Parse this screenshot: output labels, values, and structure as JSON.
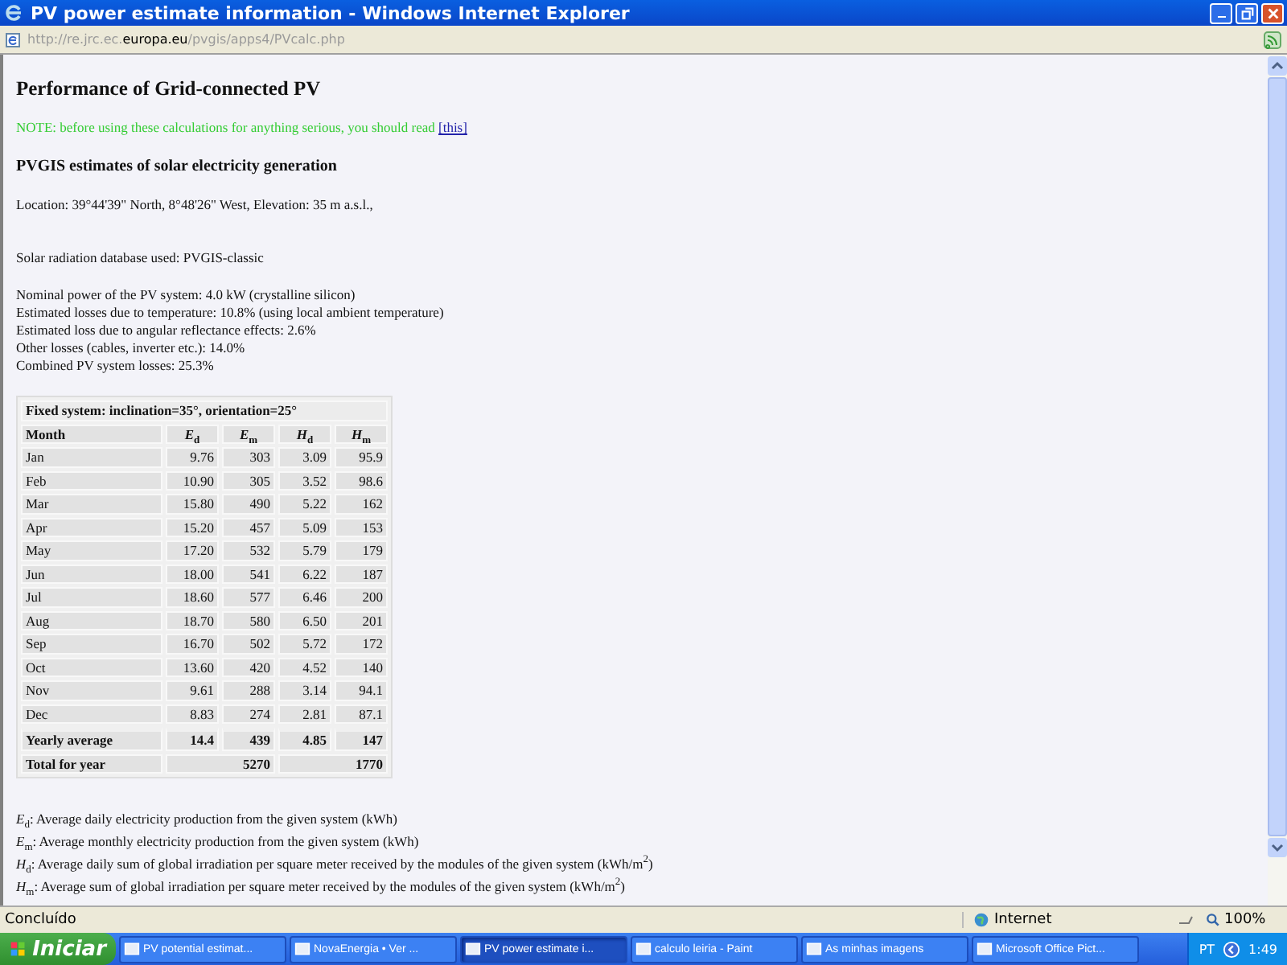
{
  "window": {
    "title": "PV power estimate information - Windows Internet Explorer"
  },
  "address": {
    "value": "http://re.jrc.ec.**europa.eu**/pvgis/apps4/PVcalc.php"
  },
  "page": {
    "title": "Performance of Grid-connected PV",
    "note": {
      "text": "NOTE: before using these calculations for anything serious, you should read",
      "link": "[this]"
    },
    "subtitle": "PVGIS estimates of solar electricity generation",
    "location": "Location: 39°44'39\" North, 8°48'26\" West, Elevation: 35 m a.s.l.,",
    "database": "Solar radiation database used: PVGIS-classic",
    "system_lines": [
      "Nominal power of the PV system: 4.0 kW (crystalline silicon)",
      "Estimated losses due to temperature: 10.8% (using local ambient temperature)",
      "Estimated loss due to angular reflectance effects: 2.6%",
      "Other losses (cables, inverter etc.): 14.0%",
      "Combined PV system losses: 25.3%"
    ],
    "table": {
      "caption": "Fixed system: inclination=35°, orientation=25°",
      "columns": [
        "Month",
        "*E*$_{d}$",
        "*E*$_{m}$",
        "*H*$_{d}$",
        "*H*$_{m}$"
      ],
      "rows": [
        {
          "kind": "month",
          "label": "Jan",
          "values": [
            "9.76",
            "303",
            "3.09",
            "95.9"
          ]
        },
        {
          "kind": "month",
          "label": "Feb",
          "values": [
            "10.90",
            "305",
            "3.52",
            "98.6"
          ]
        },
        {
          "kind": "month",
          "label": "Mar",
          "values": [
            "15.80",
            "490",
            "5.22",
            "162"
          ]
        },
        {
          "kind": "month",
          "label": "Apr",
          "values": [
            "15.20",
            "457",
            "5.09",
            "153"
          ]
        },
        {
          "kind": "month",
          "label": "May",
          "values": [
            "17.20",
            "532",
            "5.79",
            "179"
          ]
        },
        {
          "kind": "month",
          "label": "Jun",
          "values": [
            "18.00",
            "541",
            "6.22",
            "187"
          ]
        },
        {
          "kind": "month",
          "label": "Jul",
          "values": [
            "18.60",
            "577",
            "6.46",
            "200"
          ]
        },
        {
          "kind": "month",
          "label": "Aug",
          "values": [
            "18.70",
            "580",
            "6.50",
            "201"
          ]
        },
        {
          "kind": "month",
          "label": "Sep",
          "values": [
            "16.70",
            "502",
            "5.72",
            "172"
          ]
        },
        {
          "kind": "month",
          "label": "Oct",
          "values": [
            "13.60",
            "420",
            "4.52",
            "140"
          ]
        },
        {
          "kind": "month",
          "label": "Nov",
          "values": [
            "9.61",
            "288",
            "3.14",
            "94.1"
          ]
        },
        {
          "kind": "month",
          "label": "Dec",
          "values": [
            "8.83",
            "274",
            "2.81",
            "87.1"
          ]
        },
        {
          "kind": "average",
          "label": "Yearly average",
          "values": [
            "14.4",
            "439",
            "4.85",
            "147"
          ]
        },
        {
          "kind": "total",
          "label": "Total for year",
          "values": [
            "5270",
            "1770"
          ]
        }
      ]
    },
    "legend": [
      "*E*$_{d}$: Average daily electricity production from the given system (kWh)",
      "*E*$_{m}$: Average monthly electricity production from the given system (kWh)",
      "*H*$_{d}$: Average daily sum of global irradiation per square meter received by the modules of the given system (kWh/m$^{2}$)",
      "*H*$_{m}$: Average sum of global irradiation per square meter received by the modules of the given system (kWh/m$^{2}$)"
    ]
  },
  "status_bar": {
    "status": "Concluído",
    "zone": "Internet",
    "zoom": "100%"
  },
  "taskbar": {
    "start": "Iniciar",
    "items": [
      {
        "label": "PV potential estimat...",
        "selected": false
      },
      {
        "label": "NovaEnergia • Ver ...",
        "selected": false
      },
      {
        "label": "PV power estimate i...",
        "selected": true
      },
      {
        "label": "calculo leiria - Paint",
        "selected": false
      },
      {
        "label": "As minhas imagens",
        "selected": false
      },
      {
        "label": "Microsoft Office Pict...",
        "selected": false
      }
    ],
    "language": "PT",
    "clock": "1:49"
  }
}
